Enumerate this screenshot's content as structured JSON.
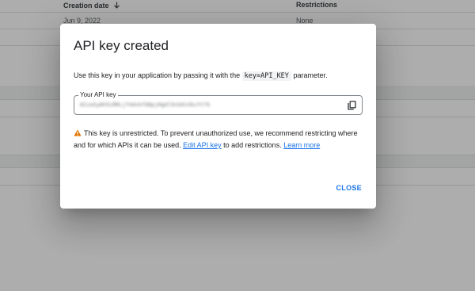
{
  "table": {
    "headers": {
      "creation_date": "Creation date",
      "restrictions": "Restrictions"
    },
    "rows": [
      {
        "creation_date": "Jun 9, 2022",
        "restrictions": "None"
      }
    ]
  },
  "dialog": {
    "title": "API key created",
    "description_prefix": "Use this key in your application by passing it with the",
    "description_code": "key=API_KEY",
    "description_suffix": "parameter.",
    "key_field": {
      "label": "Your API key",
      "value": "AIzaSyAh5LM0Ljf4dvkfQ8pjHgUl9zUdiGkvYt7k"
    },
    "warning": {
      "text": "This key is unrestricted. To prevent unauthorized use, we recommend restricting where and for which APIs it can be used.",
      "edit_link": "Edit API key",
      "middle": "to add restrictions.",
      "learn_more": "Learn more"
    },
    "close_label": "CLOSE"
  },
  "colors": {
    "accent": "#1a73e8",
    "warning": "#e37400"
  },
  "icons": {
    "copy": "copy-icon",
    "warning": "warning-icon",
    "sort": "arrow-down-icon"
  }
}
